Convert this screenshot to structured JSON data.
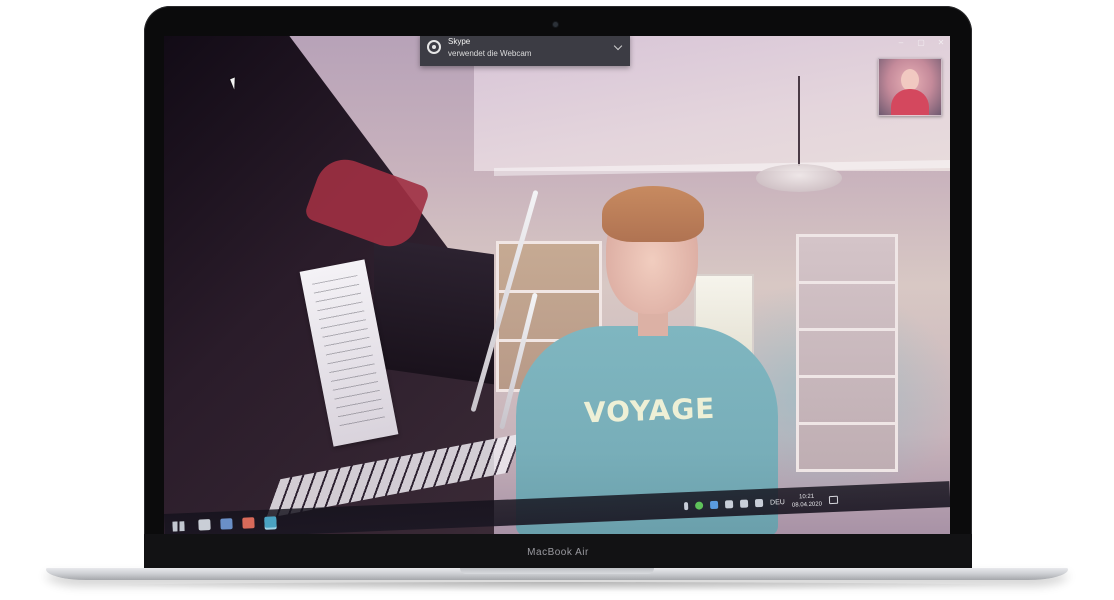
{
  "device": {
    "brand_label": "MacBook Air"
  },
  "notification": {
    "app_name": "Skype",
    "message": "verwendet die Webcam",
    "icon": "webcam-icon"
  },
  "window_controls": {
    "minimize": "–",
    "maximize": "▢",
    "close": "✕"
  },
  "video_call": {
    "main_feed_subject": "remote-video-feed",
    "self_view": "self-view-thumbnail",
    "sweater_print": "VOYAGE"
  },
  "taskbar": {
    "apps": [
      "start-icon",
      "file-explorer-icon",
      "mail-icon",
      "skype-icon",
      "browser-icon"
    ],
    "language": "DEU",
    "time": "10:21",
    "date": "08.04.2020"
  },
  "colors": {
    "bezel": "#0b0b0c",
    "aluminum": "#cfd1d5",
    "notification_bg": "#3c3c44",
    "sweater": "#7fb6c0"
  }
}
